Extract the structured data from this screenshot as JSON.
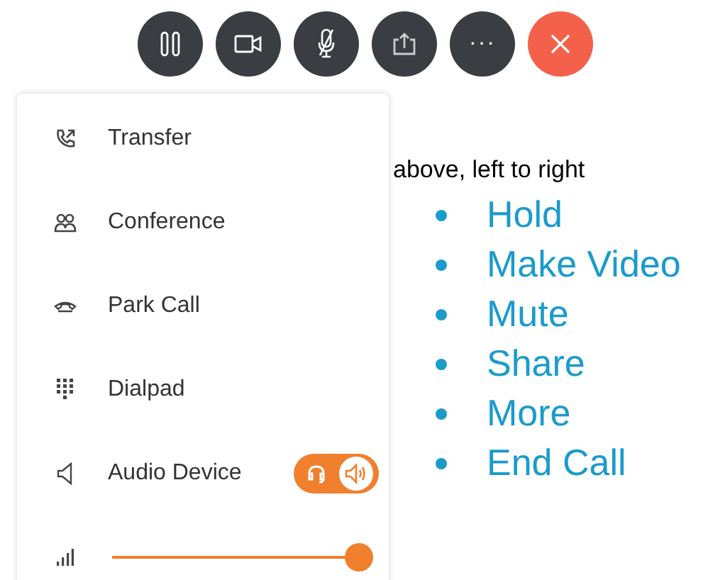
{
  "call_controls": [
    {
      "kind": "hold"
    },
    {
      "kind": "video"
    },
    {
      "kind": "mute"
    },
    {
      "kind": "share"
    },
    {
      "kind": "more",
      "label": "···"
    },
    {
      "kind": "end"
    }
  ],
  "menu": {
    "items": [
      {
        "kind": "transfer",
        "label": "Transfer"
      },
      {
        "kind": "conference",
        "label": "Conference"
      },
      {
        "kind": "park",
        "label": "Park Call"
      },
      {
        "kind": "dialpad",
        "label": "Dialpad"
      },
      {
        "kind": "audio",
        "label": "Audio Device",
        "options": [
          {
            "kind": "headset",
            "selected": false
          },
          {
            "kind": "speaker",
            "selected": true
          }
        ]
      }
    ],
    "volume": {
      "level": 1.0
    }
  },
  "annotation": {
    "title": "above, left to right",
    "items": [
      "Hold",
      "Make Video",
      "Mute",
      "Share",
      "More",
      "End Call"
    ]
  }
}
